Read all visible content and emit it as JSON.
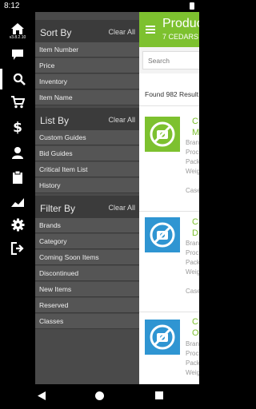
{
  "status": {
    "time": "8:12"
  },
  "rail": {
    "version": "v3.8.2.10",
    "items": [
      {
        "icon": "home-icon"
      },
      {
        "icon": "chat-icon"
      },
      {
        "icon": "search-icon"
      },
      {
        "icon": "cart-icon"
      },
      {
        "icon": "dollar-icon"
      },
      {
        "icon": "user-icon"
      },
      {
        "icon": "clipboard-icon"
      },
      {
        "icon": "chart-icon"
      },
      {
        "icon": "gear-icon"
      },
      {
        "icon": "logout-icon"
      }
    ]
  },
  "panel": {
    "sort": {
      "title": "Sort By",
      "clear": "Clear All",
      "options": [
        "Item Number",
        "Price",
        "Inventory",
        "Item Name"
      ]
    },
    "list": {
      "title": "List By",
      "clear": "Clear All",
      "options": [
        "Custom Guides",
        "Bid Guides",
        "Critical Item List",
        "History"
      ]
    },
    "filter": {
      "title": "Filter By",
      "clear": "Clear All",
      "options": [
        "Brands",
        "Category",
        "Coming Soon Items",
        "Discontinued",
        "New Items",
        "Reserved",
        "Classes"
      ]
    }
  },
  "header": {
    "title": "Produc",
    "subtitle": "7 CEDARS"
  },
  "search": {
    "placeholder": "Search"
  },
  "results": {
    "found": "Found 982 Result"
  },
  "cards": [
    {
      "name1": "C",
      "name2": "M",
      "labels": [
        "Bran",
        "Proc",
        "Pack",
        "Weig"
      ],
      "case": "Case",
      "thumb_color": "#7dc12f"
    },
    {
      "name1": "C",
      "name2": "D",
      "labels": [
        "Bran",
        "Proc",
        "Pack",
        "Weig"
      ],
      "case": "Case",
      "thumb_color": "#2f95d2"
    },
    {
      "name1": "C",
      "name2": "O",
      "labels": [
        "Bran",
        "Proc",
        "Pack",
        "Weig"
      ],
      "case": "",
      "thumb_color": "#2f95d2"
    }
  ],
  "colors": {
    "brand_green": "#7dc12f",
    "panel_bg": "#4a4a4a",
    "thumb_blue": "#2f95d2"
  }
}
